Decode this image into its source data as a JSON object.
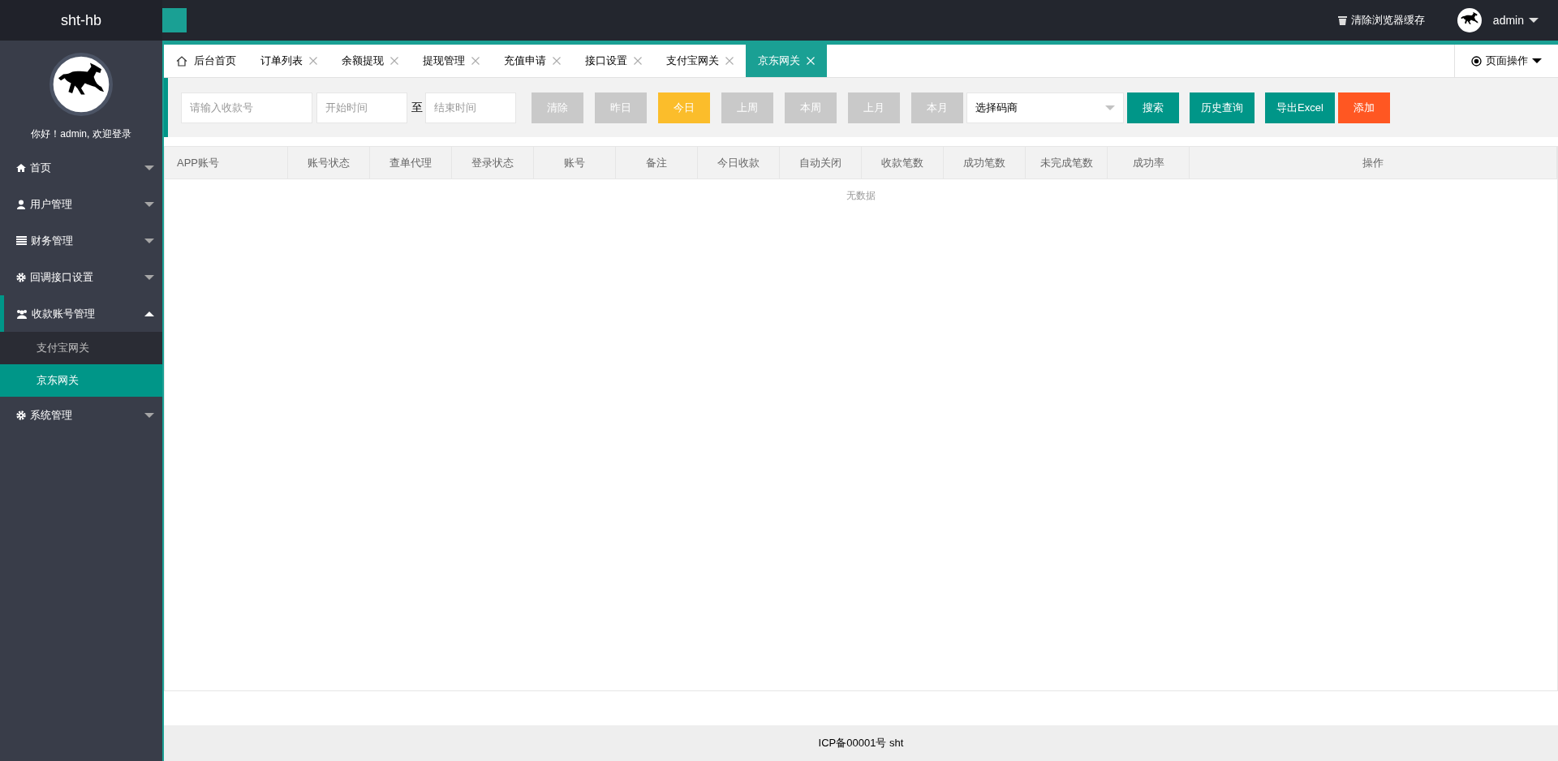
{
  "header": {
    "logo": "sht-hb",
    "clear_cache": "清除浏览器缓存",
    "user": "admin"
  },
  "sidebar": {
    "greeting": "你好！admin, 欢迎登录",
    "items": [
      {
        "label": "首页",
        "kind": "home",
        "expanded": false
      },
      {
        "label": "用户管理",
        "kind": "user",
        "expanded": false
      },
      {
        "label": "财务管理",
        "kind": "list",
        "expanded": false
      },
      {
        "label": "回调接口设置",
        "kind": "gear",
        "expanded": false
      },
      {
        "label": "收款账号管理",
        "kind": "users",
        "expanded": true,
        "children": [
          {
            "label": "支付宝网关",
            "selected": false
          },
          {
            "label": "京东网关",
            "selected": true
          }
        ]
      },
      {
        "label": "系统管理",
        "kind": "gear",
        "expanded": false
      }
    ]
  },
  "tabs": [
    {
      "label": "后台首页",
      "kind": "home",
      "selected": false
    },
    {
      "label": "订单列表",
      "kind": "page",
      "selected": false
    },
    {
      "label": "余额提现",
      "kind": "page",
      "selected": false
    },
    {
      "label": "提现管理",
      "kind": "page",
      "selected": false
    },
    {
      "label": "充值申请",
      "kind": "page",
      "selected": false
    },
    {
      "label": "接口设置",
      "kind": "page",
      "selected": false
    },
    {
      "label": "支付宝网关",
      "kind": "page",
      "selected": false
    },
    {
      "label": "京东网关",
      "kind": "page",
      "selected": true
    }
  ],
  "page_actions": "页面操作",
  "filters": {
    "account_placeholder": "请输入收款号",
    "start_placeholder": "开始时间",
    "to": "至",
    "end_placeholder": "结束时间",
    "range_buttons": [
      {
        "label": "清除",
        "selected": false
      },
      {
        "label": "昨日",
        "selected": false
      },
      {
        "label": "今日",
        "selected": true
      },
      {
        "label": "上周",
        "selected": false
      },
      {
        "label": "本周",
        "selected": false
      },
      {
        "label": "上月",
        "selected": false
      },
      {
        "label": "本月",
        "selected": false
      }
    ],
    "merchant_select": "选择码商",
    "action_buttons": [
      {
        "label": "搜索",
        "kind": "primary"
      },
      {
        "label": "历史查询",
        "kind": "primary"
      },
      {
        "label": "导出Excel",
        "kind": "primary"
      },
      {
        "label": "添加",
        "kind": "danger"
      }
    ]
  },
  "table": {
    "columns": [
      "APP账号",
      "账号状态",
      "查单代理",
      "登录状态",
      "账号",
      "备注",
      "今日收款",
      "自动关闭",
      "收款笔数",
      "成功笔数",
      "未完成笔数",
      "成功率",
      "操作"
    ],
    "empty": "无数据"
  },
  "footer": "ICP备00001号 sht"
}
